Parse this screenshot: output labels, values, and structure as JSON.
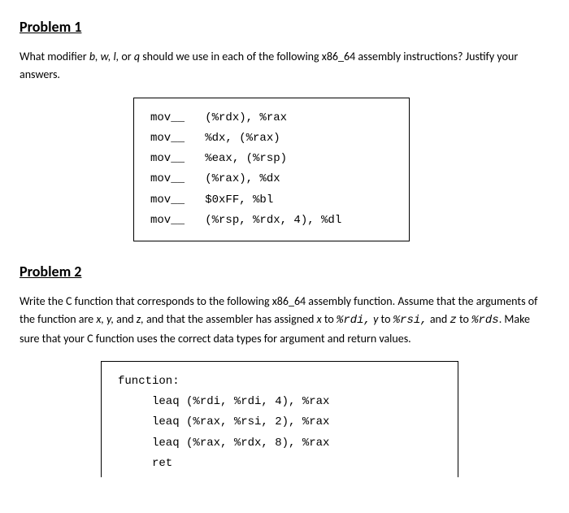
{
  "problem1": {
    "title": "Problem 1",
    "question_pre": "What modifier ",
    "modifiers": "b, w, l,",
    "question_mid": " or ",
    "modifier_q": "q",
    "question_post": " should we use in each of the following x86_64 assembly instructions? Justify your answers.",
    "code": "mov__   (%rdx), %rax\nmov__   %dx, (%rax)\nmov__   %eax, (%rsp)\nmov__   (%rax), %dx\nmov__   $0xFF, %bl\nmov__   (%rsp, %rdx, 4), %dl"
  },
  "problem2": {
    "title": "Problem 2",
    "question_p1": "Write the C function that corresponds to the following x86_64 assembly function. Assume that the arguments of the function are ",
    "x": "x, y,",
    "q_and1": " and ",
    "z": "z,",
    "q_mid1": " and that the assembler has assigned ",
    "xv": "x",
    "q_to1": " to ",
    "rdi": "%rdi,",
    "sp1": " ",
    "yv": "y",
    "q_to2": " to ",
    "rsi": "%rsi,",
    "q_and2": " and ",
    "zv": "z",
    "q_to3": " to ",
    "rds": "%rds",
    "q_end": ". Make sure that your C function uses the correct data types for argument and return values.",
    "code": "function:\n     leaq (%rdi, %rdi, 4), %rax\n     leaq (%rax, %rsi, 2), %rax\n     leaq (%rax, %rdx, 8), %rax\n     ret"
  }
}
